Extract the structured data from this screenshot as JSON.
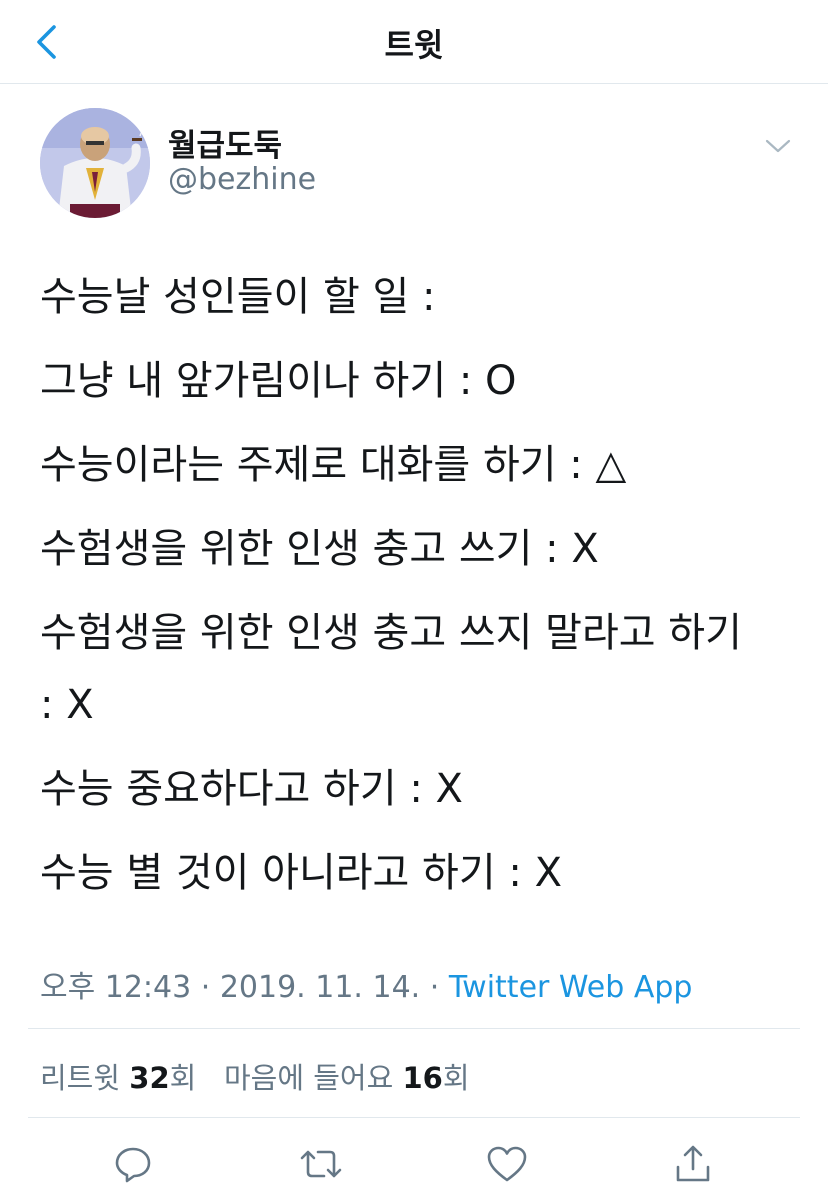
{
  "nav": {
    "title": "트윗",
    "back_icon": "chevron-left-icon"
  },
  "author": {
    "display_name": "월급도둑",
    "handle": "@bezhine",
    "avatar": "avatar-illustration",
    "menu_icon": "chevron-down-icon"
  },
  "tweet": {
    "lines": [
      "수능날 성인들이 할 일 :",
      "그냥 내 앞가림이나 하기 : O",
      "수능이라는 주제로 대화를 하기 : △",
      "수험생을 위한 인생 충고 쓰기 : X",
      "수험생을 위한 인생 충고 쓰지 말라고 하기 : X",
      "수능 중요하다고 하기 : X",
      "수능 별 것이 아니라고 하기 : X"
    ]
  },
  "meta": {
    "time": "오후 12:43",
    "separator": " · ",
    "date": "2019. 11. 14.",
    "source": "Twitter Web App"
  },
  "stats": {
    "retweet_label": "리트윗",
    "retweet_count": "32",
    "retweet_unit": "회",
    "like_label": "마음에 들어요",
    "like_count": "16",
    "like_unit": "회"
  },
  "actions": {
    "reply_icon": "reply-icon",
    "retweet_icon": "retweet-icon",
    "like_icon": "heart-icon",
    "share_icon": "share-icon"
  },
  "colors": {
    "link": "#1b95e0",
    "secondary": "#657786",
    "divider": "#e1e8ed",
    "text": "#14171a"
  }
}
